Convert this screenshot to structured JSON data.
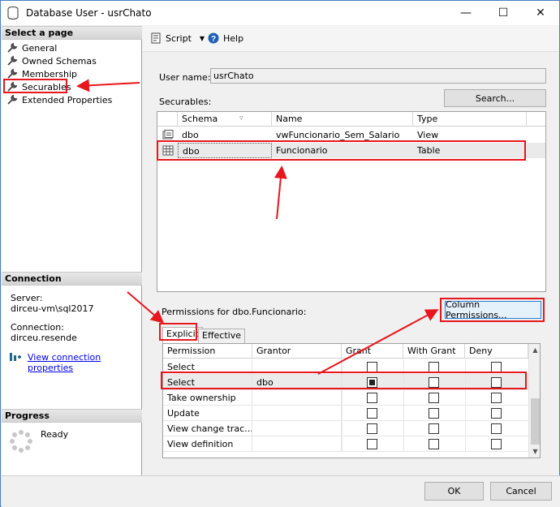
{
  "window": {
    "title": "Database User - usrChato",
    "minimize": "—",
    "maximize": "☐",
    "close": "✕"
  },
  "left": {
    "select_page_title": "Select a page",
    "pages": [
      "General",
      "Owned Schemas",
      "Membership",
      "Securables",
      "Extended Properties"
    ],
    "connection_title": "Connection",
    "server_label": "Server:",
    "server_value": "dirceu-vm\\sql2017",
    "connection_label": "Connection:",
    "connection_value": "dirceu.resende",
    "view_conn_link": "View connection properties",
    "progress_title": "Progress",
    "progress_status": "Ready"
  },
  "toolbar": {
    "script_label": "Script",
    "help_label": "Help"
  },
  "form": {
    "user_name_label": "User name:",
    "user_name_value": "usrChato",
    "securables_label": "Securables:",
    "search_button": "Search...",
    "permissions_label": "Permissions for dbo.Funcionario:",
    "column_permissions_button": "Column Permissions..."
  },
  "securables": {
    "columns": [
      "Schema",
      "Name",
      "Type"
    ],
    "rows": [
      {
        "schema": "dbo",
        "name": "vwFuncionario_Sem_Salario",
        "type": "View",
        "icon": "view-icon"
      },
      {
        "schema": "dbo",
        "name": "Funcionario",
        "type": "Table",
        "icon": "table-icon"
      }
    ]
  },
  "tabs": [
    "Explicit",
    "Effective"
  ],
  "permissions": {
    "columns": [
      "Permission",
      "Grantor",
      "Grant",
      "With Grant",
      "Deny"
    ],
    "rows": [
      {
        "permission": "Select",
        "grantor": "",
        "grant": false,
        "with_grant": false,
        "deny": false
      },
      {
        "permission": "Select",
        "grantor": "dbo",
        "grant": true,
        "with_grant": false,
        "deny": false
      },
      {
        "permission": "Take ownership",
        "grantor": "",
        "grant": false,
        "with_grant": false,
        "deny": false
      },
      {
        "permission": "Update",
        "grantor": "",
        "grant": false,
        "with_grant": false,
        "deny": false
      },
      {
        "permission": "View change trac...",
        "grantor": "",
        "grant": false,
        "with_grant": false,
        "deny": false
      },
      {
        "permission": "View definition",
        "grantor": "",
        "grant": false,
        "with_grant": false,
        "deny": false
      }
    ]
  },
  "footer": {
    "ok_button": "OK",
    "cancel_button": "Cancel"
  },
  "colors": {
    "annotation": "#e8161d",
    "link": "#0000ee",
    "focus": "#2a7fd4"
  }
}
